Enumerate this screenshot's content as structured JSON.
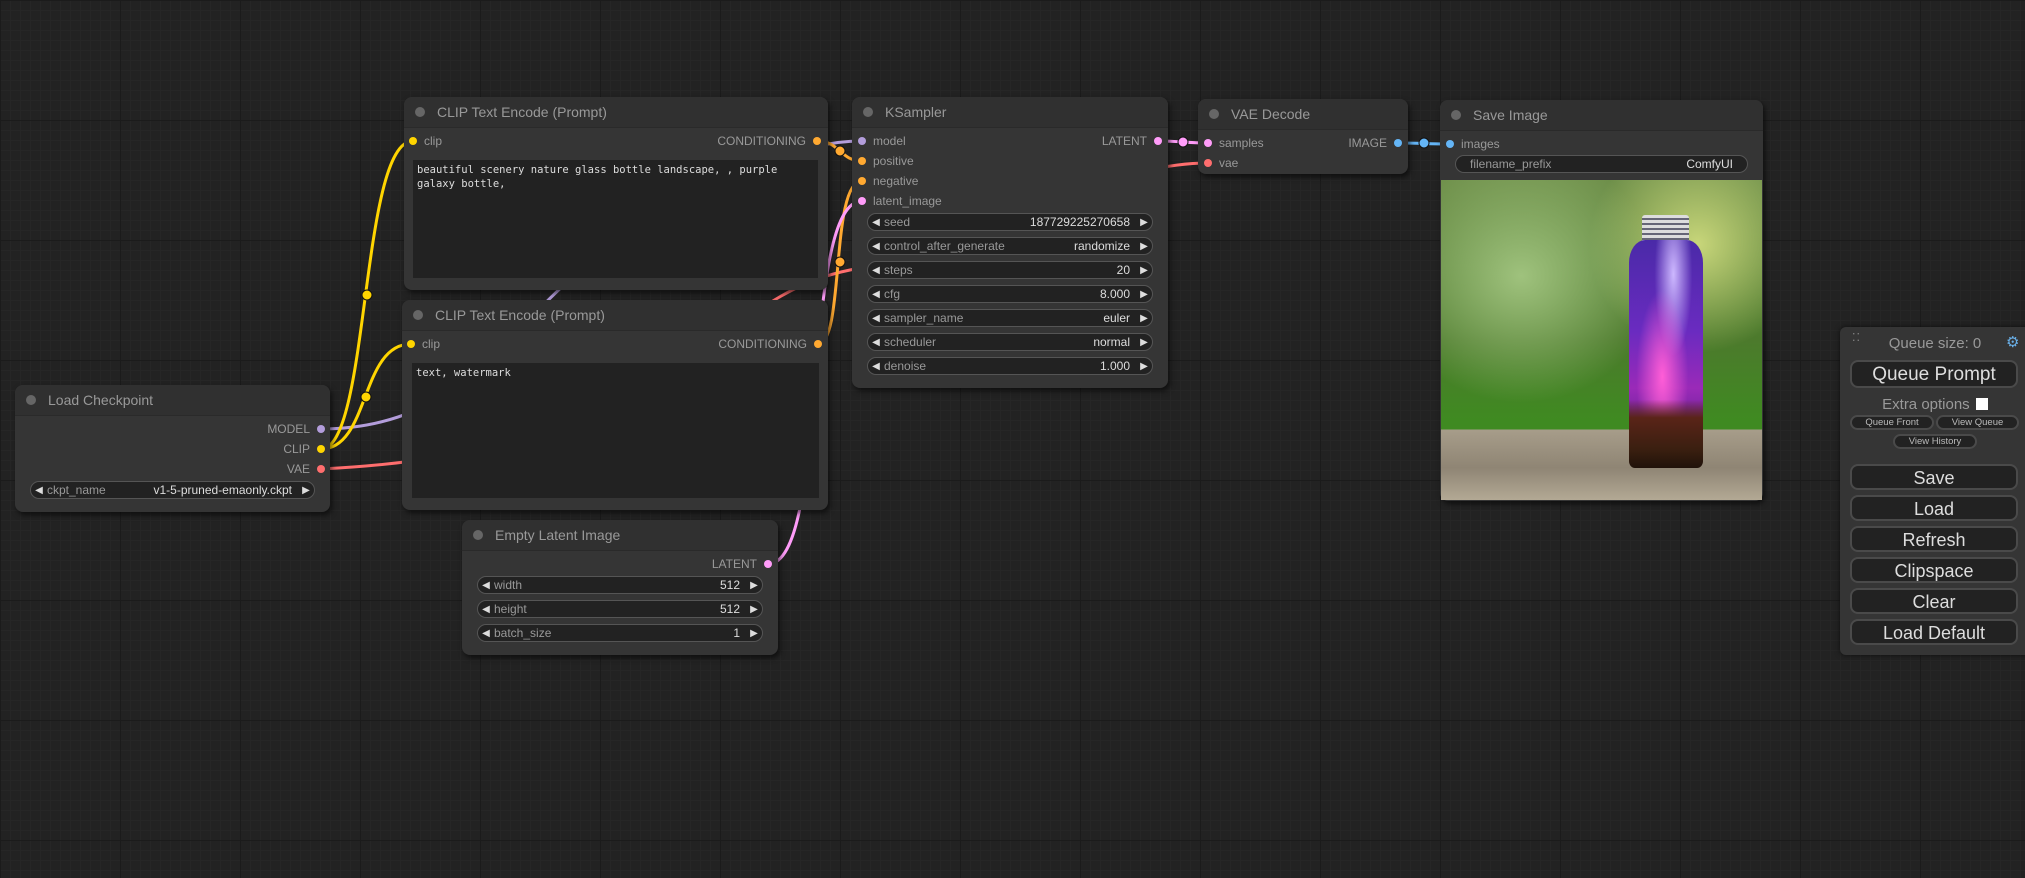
{
  "colors": {
    "model": "#b39ddb",
    "clip": "#ffd500",
    "vae": "#ff6e6e",
    "conditioning": "#ffa931",
    "latent": "#ff9cf9",
    "image": "#64b5f6"
  },
  "nodes": {
    "load_checkpoint": {
      "title": "Load Checkpoint",
      "outputs": [
        "MODEL",
        "CLIP",
        "VAE"
      ],
      "widgets": [
        {
          "label": "ckpt_name",
          "value": "v1-5-pruned-emaonly.ckpt"
        }
      ]
    },
    "clip_positive": {
      "title": "CLIP Text Encode (Prompt)",
      "input": "clip",
      "output": "CONDITIONING",
      "text": "beautiful scenery nature glass bottle landscape, , purple galaxy bottle,"
    },
    "clip_negative": {
      "title": "CLIP Text Encode (Prompt)",
      "input": "clip",
      "output": "CONDITIONING",
      "text": "text, watermark"
    },
    "ksampler": {
      "title": "KSampler",
      "inputs": [
        "model",
        "positive",
        "negative",
        "latent_image"
      ],
      "output": "LATENT",
      "widgets": [
        {
          "label": "seed",
          "value": "187729225270658"
        },
        {
          "label": "control_after_generate",
          "value": "randomize"
        },
        {
          "label": "steps",
          "value": "20"
        },
        {
          "label": "cfg",
          "value": "8.000"
        },
        {
          "label": "sampler_name",
          "value": "euler"
        },
        {
          "label": "scheduler",
          "value": "normal"
        },
        {
          "label": "denoise",
          "value": "1.000"
        }
      ]
    },
    "vae_decode": {
      "title": "VAE Decode",
      "inputs": [
        "samples",
        "vae"
      ],
      "output": "IMAGE"
    },
    "save_image": {
      "title": "Save Image",
      "input": "images",
      "widgets": [
        {
          "label": "filename_prefix",
          "value": "ComfyUI"
        }
      ],
      "image_description": "purple galaxy glass bottle on wooden table with green forest background"
    },
    "empty_latent": {
      "title": "Empty Latent Image",
      "output": "LATENT",
      "widgets": [
        {
          "label": "width",
          "value": "512"
        },
        {
          "label": "height",
          "value": "512"
        },
        {
          "label": "batch_size",
          "value": "1"
        }
      ]
    }
  },
  "queue_panel": {
    "queue_size": "Queue size: 0",
    "queue_prompt": "Queue Prompt",
    "extra_options": "Extra options",
    "extra_options_checked": false,
    "queue_front": "Queue Front",
    "view_queue": "View Queue",
    "view_history": "View History",
    "buttons": [
      "Save",
      "Load",
      "Refresh",
      "Clipspace",
      "Clear",
      "Load Default"
    ]
  }
}
